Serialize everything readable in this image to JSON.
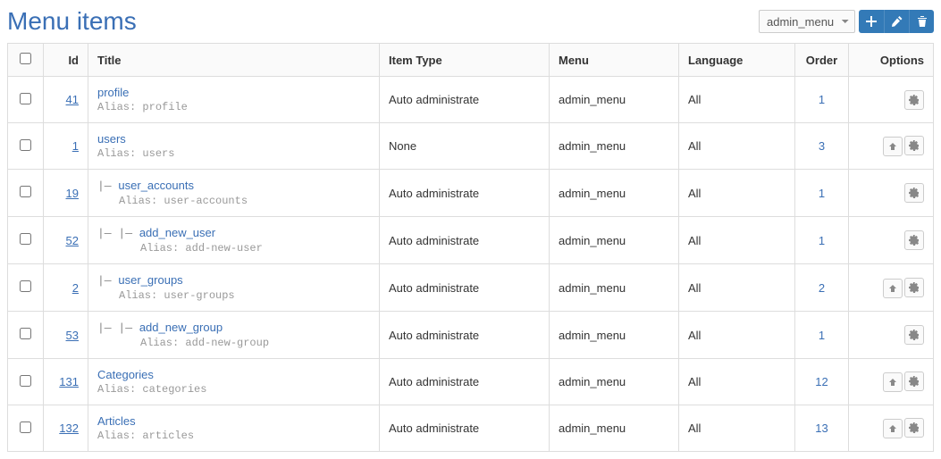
{
  "page_title": "Menu items",
  "menu_select": {
    "value": "admin_menu"
  },
  "columns": {
    "id": "Id",
    "title": "Title",
    "item_type": "Item Type",
    "menu": "Menu",
    "language": "Language",
    "order": "Order",
    "options": "Options"
  },
  "alias_label": "Alias: ",
  "rows": [
    {
      "id": "41",
      "depth": 0,
      "title": "profile",
      "alias": "profile",
      "item_type": "Auto administrate",
      "menu": "admin_menu",
      "language": "All",
      "order": "1",
      "has_up": false
    },
    {
      "id": "1",
      "depth": 0,
      "title": "users",
      "alias": "users",
      "item_type": "None",
      "menu": "admin_menu",
      "language": "All",
      "order": "3",
      "has_up": true
    },
    {
      "id": "19",
      "depth": 1,
      "title": "user_accounts",
      "alias": "user-accounts",
      "item_type": "Auto administrate",
      "menu": "admin_menu",
      "language": "All",
      "order": "1",
      "has_up": false
    },
    {
      "id": "52",
      "depth": 2,
      "title": "add_new_user",
      "alias": "add-new-user",
      "item_type": "Auto administrate",
      "menu": "admin_menu",
      "language": "All",
      "order": "1",
      "has_up": false
    },
    {
      "id": "2",
      "depth": 1,
      "title": "user_groups",
      "alias": "user-groups",
      "item_type": "Auto administrate",
      "menu": "admin_menu",
      "language": "All",
      "order": "2",
      "has_up": true
    },
    {
      "id": "53",
      "depth": 2,
      "title": "add_new_group",
      "alias": "add-new-group",
      "item_type": "Auto administrate",
      "menu": "admin_menu",
      "language": "All",
      "order": "1",
      "has_up": false
    },
    {
      "id": "131",
      "depth": 0,
      "title": "Categories",
      "alias": "categories",
      "item_type": "Auto administrate",
      "menu": "admin_menu",
      "language": "All",
      "order": "12",
      "has_up": true
    },
    {
      "id": "132",
      "depth": 0,
      "title": "Articles",
      "alias": "articles",
      "item_type": "Auto administrate",
      "menu": "admin_menu",
      "language": "All",
      "order": "13",
      "has_up": true
    }
  ]
}
